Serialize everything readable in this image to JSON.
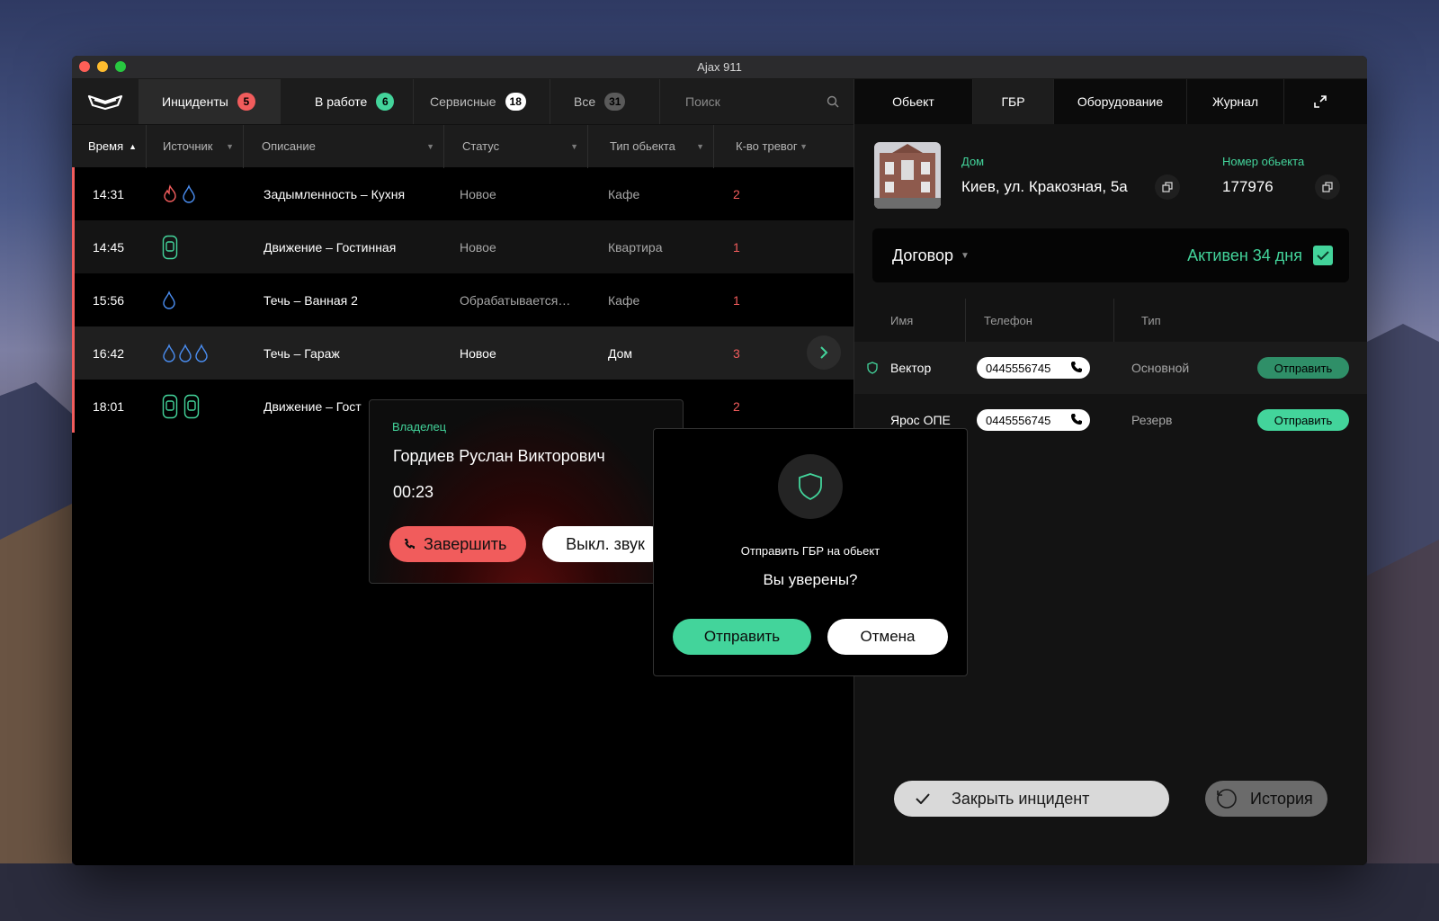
{
  "window": {
    "title": "Ajax 911"
  },
  "tabs": [
    {
      "label": "Инциденты",
      "count": "5"
    },
    {
      "label": "В работе",
      "count": "6"
    },
    {
      "label": "Сервисные",
      "count": "18"
    },
    {
      "label": "Все",
      "count": "31"
    }
  ],
  "search": {
    "placeholder": "Поиск"
  },
  "table": {
    "columns": [
      "Время",
      "Источник",
      "Описание",
      "Статус",
      "Тип обьекта",
      "К-во тревог"
    ],
    "rows": [
      {
        "time": "14:31",
        "source": [
          "fire-icon",
          "water-drop-icon"
        ],
        "description": "Задымленность – Кухня",
        "status": "Новое",
        "object_type": "Кафе",
        "alarms": "2"
      },
      {
        "time": "14:45",
        "source": [
          "motion-sensor-icon"
        ],
        "description": "Движение – Гостинная",
        "status": "Новое",
        "object_type": "Квартира",
        "alarms": "1"
      },
      {
        "time": "15:56",
        "source": [
          "water-drop-icon"
        ],
        "description": "Течь – Ванная 2",
        "status": "Обрабатывается…",
        "object_type": "Кафе",
        "alarms": "1"
      },
      {
        "time": "16:42",
        "source": [
          "water-drop-icon",
          "water-drop-icon",
          "water-drop-icon"
        ],
        "description": "Течь – Гараж",
        "status": "Новое",
        "object_type": "Дом",
        "alarms": "3"
      },
      {
        "time": "18:01",
        "source": [
          "motion-sensor-icon",
          "motion-sensor-icon"
        ],
        "description": "Движение – Гост",
        "status": "",
        "object_type": "",
        "alarms": "2"
      }
    ]
  },
  "right_tabs": [
    "Обьект",
    "ГБР",
    "Оборудование",
    "Журнал"
  ],
  "object": {
    "label": "Дом",
    "address": "Киев, ул. Кракозная, 5а",
    "number_label": "Номер обьекта",
    "number": "177976"
  },
  "contract": {
    "title": "Договор",
    "status": "Активен 34 дня"
  },
  "gbr": {
    "columns": [
      "Имя",
      "Телефон",
      "Тип"
    ],
    "rows": [
      {
        "name": "Вектор",
        "phone": "0445556745",
        "type": "Основной",
        "action": "Отправить"
      },
      {
        "name": "Ярос ОПЕ",
        "phone": "0445556745",
        "type": "Резерв",
        "action": "Отправить"
      }
    ]
  },
  "footer": {
    "close_label": "Закрыть инцидент",
    "history_label": "История"
  },
  "call": {
    "owner_label": "Владелец",
    "name": "Гордиев Руслан Викторович",
    "timer": "00:23",
    "end_label": "Завершить",
    "mute_label": "Выкл. звук"
  },
  "confirm": {
    "line1": "Отправить ГБР на обьект",
    "line2": "Вы уверены?",
    "send_label": "Отправить",
    "cancel_label": "Отмена"
  },
  "colors": {
    "accent_green": "#43d49b",
    "alert_red": "#f15c5c",
    "drop_blue": "#4a8df0"
  }
}
